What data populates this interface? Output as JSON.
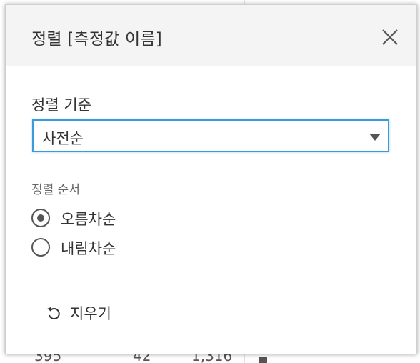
{
  "background": {
    "row_cells": [
      "395",
      "42",
      "1,316"
    ]
  },
  "dialog": {
    "title": "정렬 [측정값 이름]",
    "close_icon": "close-icon",
    "sort_by": {
      "label": "정렬 기준",
      "selected": "사전순"
    },
    "sort_order": {
      "label": "정렬 순서",
      "options": [
        {
          "label": "오름차순",
          "checked": true
        },
        {
          "label": "내림차순",
          "checked": false
        }
      ]
    },
    "clear": {
      "label": "지우기",
      "icon": "undo-icon"
    }
  },
  "colors": {
    "accent": "#3a9bdc",
    "header_bg": "#f4f4f4"
  }
}
